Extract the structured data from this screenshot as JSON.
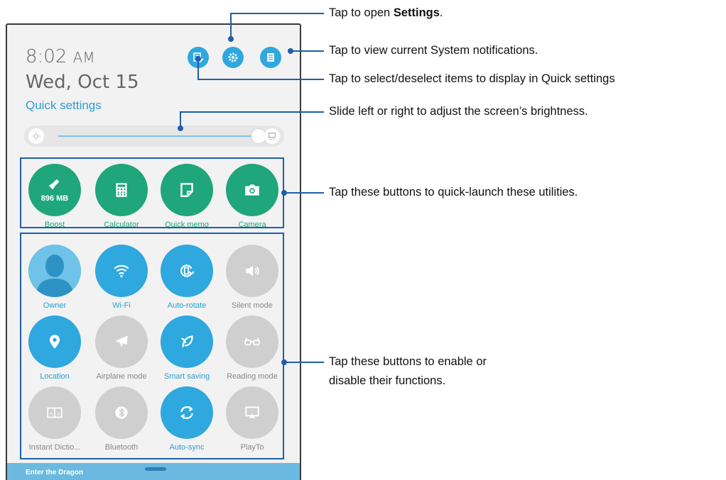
{
  "status": {
    "time": "8:02",
    "ampm": "AM",
    "date": "Wed, Oct 15"
  },
  "quick_settings_label": "Quick settings",
  "top_icons": [
    "edit-icon",
    "settings-icon",
    "notifications-icon"
  ],
  "brightness": {
    "level": 0.9,
    "auto_label": "AUTO"
  },
  "utilities": [
    {
      "label": "Boost",
      "sublabel": "896 MB",
      "icon": "broom-icon"
    },
    {
      "label": "Calculator",
      "icon": "calculator-icon"
    },
    {
      "label": "Quick memo",
      "icon": "memo-icon"
    },
    {
      "label": "Camera",
      "icon": "camera-icon"
    }
  ],
  "toggles": [
    {
      "label": "Owner",
      "icon": "avatar-icon",
      "state": "on"
    },
    {
      "label": "Wi-Fi",
      "icon": "wifi-icon",
      "state": "on"
    },
    {
      "label": "Auto-rotate",
      "icon": "rotate-icon",
      "state": "on"
    },
    {
      "label": "Silent mode",
      "icon": "speaker-icon",
      "state": "off"
    },
    {
      "label": "Location",
      "icon": "location-icon",
      "state": "on"
    },
    {
      "label": "Airplane mode",
      "icon": "airplane-icon",
      "state": "off"
    },
    {
      "label": "Smart saving",
      "icon": "leaf-icon",
      "state": "on"
    },
    {
      "label": "Reading mode",
      "icon": "glasses-icon",
      "state": "off"
    },
    {
      "label": "Instant Dictio...",
      "icon": "dictionary-icon",
      "state": "off"
    },
    {
      "label": "Bluetooth",
      "icon": "bluetooth-icon",
      "state": "off"
    },
    {
      "label": "Auto-sync",
      "icon": "sync-icon",
      "state": "on"
    },
    {
      "label": "PlayTo",
      "icon": "cast-icon",
      "state": "off"
    }
  ],
  "bottom_bar": {
    "text": "Enter the Dragon"
  },
  "callouts": {
    "settings_prefix": "Tap to open ",
    "settings_bold": "Settings",
    "settings_suffix": ".",
    "notifications": "Tap to view current System notifications.",
    "select": "Tap to select/deselect items to display in Quick settings",
    "brightness": "Slide left or right to adjust the screen’s brightness.",
    "utilities": "Tap these buttons to quick-launch these utilities.",
    "toggles_line1": "Tap these buttons to enable or",
    "toggles_line2": "disable their functions."
  },
  "colors": {
    "accent_blue": "#2ea8de",
    "accent_green": "#1fa67a",
    "off_gray": "#cfcfcf",
    "callout_line": "#1e5fa8"
  }
}
